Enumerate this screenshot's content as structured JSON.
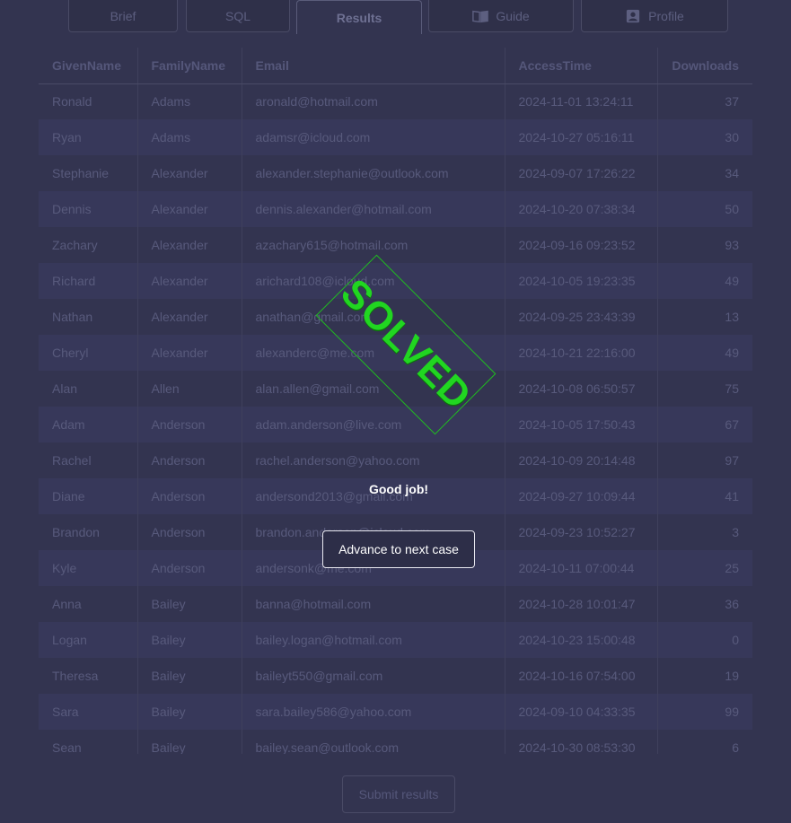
{
  "tabs": [
    {
      "label": "Brief",
      "icon": ""
    },
    {
      "label": "SQL",
      "icon": ""
    },
    {
      "label": "Results",
      "icon": "",
      "active": true
    },
    {
      "label": "Guide",
      "icon": "book-icon"
    },
    {
      "label": "Profile",
      "icon": "profile-card-icon"
    }
  ],
  "table": {
    "columns": [
      "GivenName",
      "FamilyName",
      "Email",
      "AccessTime",
      "Downloads"
    ],
    "rows": [
      [
        "Ronald",
        "Adams",
        "aronald@hotmail.com",
        "2024-11-01 13:24:11",
        "37"
      ],
      [
        "Ryan",
        "Adams",
        "adamsr@icloud.com",
        "2024-10-27 05:16:11",
        "30"
      ],
      [
        "Stephanie",
        "Alexander",
        "alexander.stephanie@outlook.com",
        "2024-09-07 17:26:22",
        "34"
      ],
      [
        "Dennis",
        "Alexander",
        "dennis.alexander@hotmail.com",
        "2024-10-20 07:38:34",
        "50"
      ],
      [
        "Zachary",
        "Alexander",
        "azachary615@hotmail.com",
        "2024-09-16 09:23:52",
        "93"
      ],
      [
        "Richard",
        "Alexander",
        "arichard108@icloud.com",
        "2024-10-05 19:23:35",
        "49"
      ],
      [
        "Nathan",
        "Alexander",
        "anathan@gmail.com",
        "2024-09-25 23:43:39",
        "13"
      ],
      [
        "Cheryl",
        "Alexander",
        "alexanderc@me.com",
        "2024-10-21 22:16:00",
        "49"
      ],
      [
        "Alan",
        "Allen",
        "alan.allen@gmail.com",
        "2024-10-08 06:50:57",
        "75"
      ],
      [
        "Adam",
        "Anderson",
        "adam.anderson@live.com",
        "2024-10-05 17:50:43",
        "67"
      ],
      [
        "Rachel",
        "Anderson",
        "rachel.anderson@yahoo.com",
        "2024-10-09 20:14:48",
        "97"
      ],
      [
        "Diane",
        "Anderson",
        "andersond2013@gmail.com",
        "2024-09-27 10:09:44",
        "41"
      ],
      [
        "Brandon",
        "Anderson",
        "brandon.anderson@icloud.com",
        "2024-09-23 10:52:27",
        "3"
      ],
      [
        "Kyle",
        "Anderson",
        "andersonk@me.com",
        "2024-10-11 07:00:44",
        "25"
      ],
      [
        "Anna",
        "Bailey",
        "banna@hotmail.com",
        "2024-10-28 10:01:47",
        "36"
      ],
      [
        "Logan",
        "Bailey",
        "bailey.logan@hotmail.com",
        "2024-10-23 15:00:48",
        "0"
      ],
      [
        "Theresa",
        "Bailey",
        "baileyt550@gmail.com",
        "2024-10-16 07:54:00",
        "19"
      ],
      [
        "Sara",
        "Bailey",
        "sara.bailey586@yahoo.com",
        "2024-09-10 04:33:35",
        "99"
      ],
      [
        "Sean",
        "Bailey",
        "bailey.sean@outlook.com",
        "2024-10-30 08:53:30",
        "6"
      ]
    ]
  },
  "submit_label": "Submit results",
  "overlay": {
    "stamp_text": "SOLVED",
    "message": "Good job!",
    "advance_label": "Advance to next case"
  },
  "colors": {
    "background": "#333450",
    "stamp_green": "#21d621",
    "text_dim": "#585a7c"
  }
}
